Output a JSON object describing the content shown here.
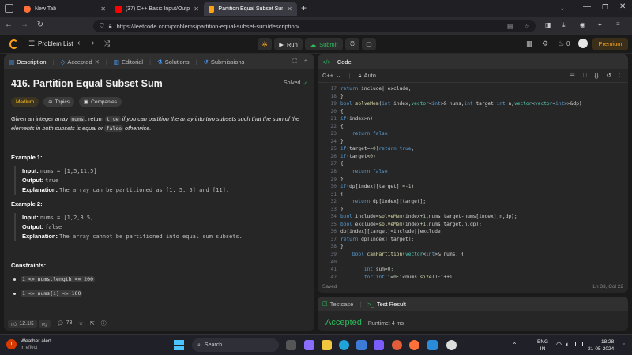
{
  "browser": {
    "tabs": [
      {
        "label": "New Tab",
        "active": false
      },
      {
        "label": "(37) C++ Basic Input/Output &",
        "active": false
      },
      {
        "label": "Partition Equal Subset Sum - Le",
        "active": true
      }
    ],
    "url": "https://leetcode.com/problems/partition-equal-subset-sum/description/"
  },
  "lcnav": {
    "problem_list": "Problem List",
    "run": "Run",
    "submit": "Submit",
    "streak": "0",
    "premium": "Premium"
  },
  "left_tabs": [
    "Description",
    "Accepted",
    "Editorial",
    "Solutions",
    "Submissions"
  ],
  "problem": {
    "title": "416. Partition Equal Subset Sum",
    "status": "Solved",
    "difficulty": "Medium",
    "topics": "Topics",
    "companies": "Companies",
    "desc_1": "Given an integer array ",
    "desc_nums": "nums",
    "desc_2": ", return ",
    "desc_true": "true",
    "desc_3": " if you can partition the array into two subsets such that the sum of the",
    "desc_4": "elements in both subsets is equal or ",
    "desc_false": "false",
    "desc_5": " otherwise.",
    "examples": [
      {
        "title": "Example 1:",
        "input": "nums = [1,5,11,5]",
        "output": "true",
        "explanation": "The array can be partitioned as [1, 5, 5] and [11]."
      },
      {
        "title": "Example 2:",
        "input": "nums = [1,2,3,5]",
        "output": "false",
        "explanation": "The array cannot be partitioned into equal sum subsets."
      }
    ],
    "input_label": "Input:",
    "output_label": "Output:",
    "explanation_label": "Explanation:",
    "constraints_title": "Constraints:",
    "constraints": [
      "1 <= nums.length <= 200",
      "1 <= nums[i] <= 100"
    ],
    "likes": "12.1K",
    "comments": "73"
  },
  "code_panel": {
    "title": "Code",
    "language": "C++",
    "mode": "Auto",
    "saved": "Saved",
    "cursor": "Ln 33, Col 22",
    "line_numbers": [
      "17",
      "18",
      "19",
      "20",
      "21",
      "22",
      "23",
      "24",
      "25",
      "26",
      "27",
      "28",
      "29",
      "30",
      "31",
      "32",
      "33",
      "34",
      "35",
      "36",
      "37",
      "38",
      "39",
      "40",
      "41",
      "42"
    ],
    "lines": [
      "return include||exclude;",
      "}",
      "bool solveMem(int index,vector<int>& nums,int target,int n,vector<vector<int>>&dp)",
      "{",
      "if(index>n)",
      "{",
      "    return false;",
      "}",
      "if(target==0)return true;",
      "if(target<0)",
      "{",
      "    return false;",
      "}",
      "if(dp[index][target]!=-1)",
      "{",
      "    return dp[index][target];",
      "}",
      "bool include=solveMem(index+1,nums,target-nums[index],n,dp);",
      "bool exclude=solveMem(index+1,nums,target,n,dp);",
      "dp[index][target]=include||exclude;",
      "return dp[index][target];",
      "}",
      "    bool canPartition(vector<int>& nums) {",
      "",
      "        int sum=0;",
      "        for(int i=0;i<nums.size();i++)"
    ]
  },
  "result_panel": {
    "tab_testcase": "Testcase",
    "tab_result": "Test Result",
    "verdict": "Accepted",
    "runtime": "Runtime: 4 ms"
  },
  "taskbar": {
    "weather_title": "Weather alert",
    "weather_sub": "In effect",
    "search": "Search",
    "lang_1": "ENG",
    "lang_2": "IN",
    "time": "18:28",
    "date": "21-05-2024"
  },
  "colors": {
    "accent_orange": "#ffa116",
    "accepted_green": "#2cbb5d",
    "medium_yellow": "#ffc01e"
  }
}
